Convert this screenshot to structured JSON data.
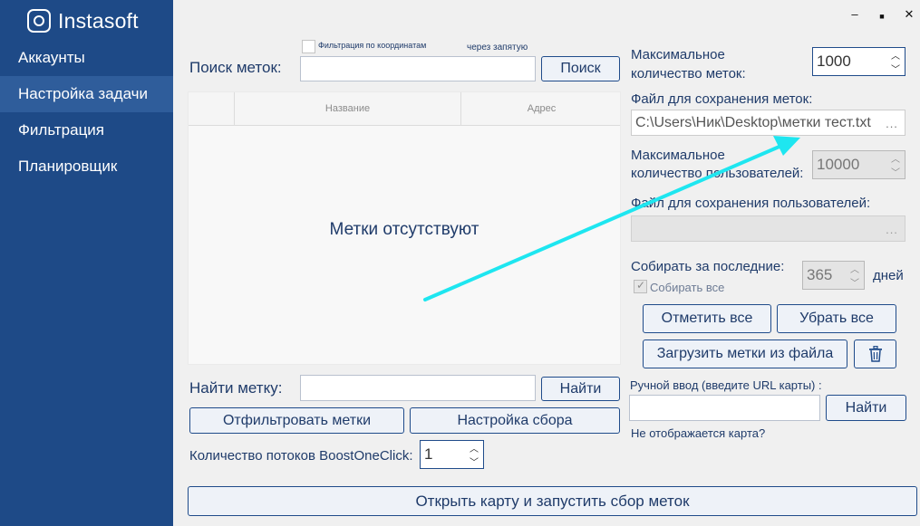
{
  "app": {
    "brand": "Instasoft"
  },
  "sidebar": {
    "items": [
      {
        "label": "Аккаунты",
        "active": false
      },
      {
        "label": "Настройка задачи",
        "active": true
      },
      {
        "label": "Фильтрация",
        "active": false
      },
      {
        "label": "Планировщик",
        "active": false
      }
    ]
  },
  "window_controls": {
    "minimize": "–",
    "maximize": "■",
    "close": "✕"
  },
  "search": {
    "filter_checkbox_label": "Фильтрация по координатам",
    "comma_hint": "через запятую",
    "label": "Поиск меток:",
    "value": "",
    "button": "Поиск"
  },
  "table": {
    "columns": [
      "",
      "Название",
      "Адрес"
    ],
    "empty_message": "Метки отсутствуют"
  },
  "find": {
    "label": "Найти метку:",
    "value": "",
    "button": "Найти"
  },
  "actions": {
    "filter_button": "Отфильтровать метки",
    "collect_settings_button": "Настройка сбора"
  },
  "threads": {
    "label": "Количество потоков BoostOneClick:",
    "value": "1"
  },
  "open_map_button": "Открыть карту и запустить сбор меток",
  "right": {
    "max_marks_label_1": "Максимальное",
    "max_marks_label_2": "количество меток:",
    "max_marks_value": "1000",
    "marks_file_label": "Файл для сохранения меток:",
    "marks_file_value": "C:\\Users\\Ник\\Desktop\\метки тест.txt",
    "browse": "...",
    "max_users_label_1": "Максимальное",
    "max_users_label_2": "количество пользователей:",
    "max_users_value": "10000",
    "users_file_label": "Файл для сохранения пользователей:",
    "users_file_value": "",
    "collect_last_label": "Собирать за последние:",
    "collect_last_value": "365",
    "days_label": "дней",
    "collect_all_label": "Собирать все",
    "mark_all_button": "Отметить все",
    "unmark_all_button": "Убрать все",
    "load_file_button": "Загрузить метки из файла",
    "manual_label": "Ручной ввод (введите URL карты) :",
    "manual_value": "",
    "manual_find_button": "Найти",
    "map_missing_link": "Не отображается карта?"
  },
  "colors": {
    "sidebar": "#1e4a87",
    "sidebar_active": "#2f5d9b",
    "text": "#1f3b6a",
    "arrow": "#1ee6f0"
  }
}
